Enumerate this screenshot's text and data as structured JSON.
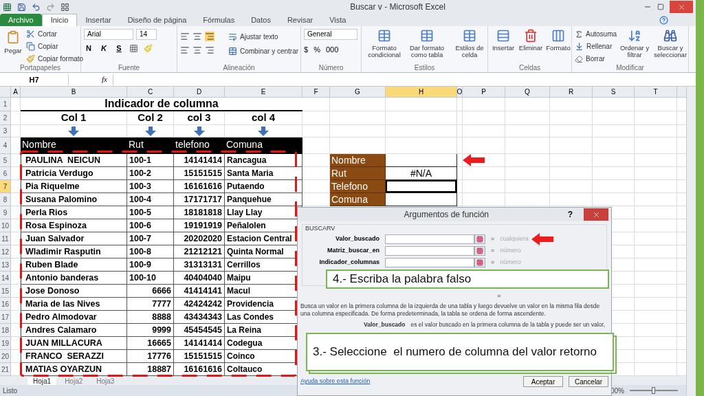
{
  "title_bar": {
    "title": "Buscar v - Microsoft Excel"
  },
  "ribbon_tabs": [
    {
      "label": "Archivo",
      "kind": "file",
      "selected": false
    },
    {
      "label": "Inicio",
      "kind": "tab",
      "selected": true
    },
    {
      "label": "Insertar",
      "kind": "tab",
      "selected": false
    },
    {
      "label": "Diseño de página",
      "kind": "tab",
      "selected": false
    },
    {
      "label": "Fórmulas",
      "kind": "tab",
      "selected": false
    },
    {
      "label": "Datos",
      "kind": "tab",
      "selected": false
    },
    {
      "label": "Revisar",
      "kind": "tab",
      "selected": false
    },
    {
      "label": "Vista",
      "kind": "tab",
      "selected": false
    }
  ],
  "ribbon": {
    "clipboard": {
      "label": "Portapapeles",
      "paste": "Pegar",
      "cut": "Cortar",
      "copy": "Copiar",
      "format_painter": "Copiar formato"
    },
    "font": {
      "label": "Fuente",
      "family": "Arial",
      "size": "14",
      "bold": "N",
      "italic": "K",
      "underline": "S"
    },
    "alignment": {
      "label": "Alineación",
      "wrap": "Ajustar texto",
      "merge": "Combinar y centrar"
    },
    "number": {
      "label": "Número",
      "format": "General",
      "currency": "$",
      "percent": "%",
      "thousands": "000"
    },
    "styles": {
      "label": "Estilos",
      "items": [
        "Formato condicional",
        "Dar formato como tabla",
        "Estilos de celda"
      ]
    },
    "cells": {
      "label": "Celdas",
      "items": [
        "Insertar",
        "Eliminar",
        "Formato"
      ]
    },
    "editing": {
      "label": "Modificar",
      "autosum": "Autosuma",
      "fill": "Rellenar",
      "clear": "Borrar",
      "sort": "Ordenar y filtrar",
      "find": "Buscar y seleccionar"
    }
  },
  "formula_bar": {
    "name_box": "H7",
    "fx": "fx"
  },
  "columns": [
    {
      "label": "A",
      "selected": false
    },
    {
      "label": "B",
      "selected": false
    },
    {
      "label": "C",
      "selected": false
    },
    {
      "label": "D",
      "selected": false
    },
    {
      "label": "E",
      "selected": false
    },
    {
      "label": "F",
      "selected": false
    },
    {
      "label": "G",
      "selected": false
    },
    {
      "label": "H",
      "selected": true
    },
    {
      "label": "O",
      "selected": false
    },
    {
      "label": "P",
      "selected": false
    },
    {
      "label": "Q",
      "selected": false
    },
    {
      "label": "R",
      "selected": false
    },
    {
      "label": "S",
      "selected": false
    },
    {
      "label": "T",
      "selected": false
    }
  ],
  "rows": [
    {
      "label": "1",
      "selected": false
    },
    {
      "label": "2",
      "selected": false
    },
    {
      "label": "3",
      "selected": false
    },
    {
      "label": "4",
      "selected": false
    },
    {
      "label": "5",
      "selected": false
    },
    {
      "label": "6",
      "selected": false
    },
    {
      "label": "7",
      "selected": true
    },
    {
      "label": "8",
      "selected": false
    },
    {
      "label": "9",
      "selected": false
    },
    {
      "label": "10",
      "selected": false
    },
    {
      "label": "11",
      "selected": false
    },
    {
      "label": "12",
      "selected": false
    },
    {
      "label": "13",
      "selected": false
    },
    {
      "label": "14",
      "selected": false
    },
    {
      "label": "15",
      "selected": false
    },
    {
      "label": "16",
      "selected": false
    },
    {
      "label": "17",
      "selected": false
    },
    {
      "label": "18",
      "selected": false
    },
    {
      "label": "19",
      "selected": false
    },
    {
      "label": "20",
      "selected": false
    },
    {
      "label": "21",
      "selected": false
    }
  ],
  "sheet": {
    "title": "Indicador de columna",
    "column_labels": [
      "Col 1",
      "Col 2",
      "col 3",
      "col 4"
    ],
    "header": [
      "Nombre",
      "Rut",
      "telefono",
      "Comuna"
    ],
    "records": [
      {
        "nombre": "PAULINA  NEICUN",
        "rut": "100-1",
        "rut_numeric": false,
        "telefono": "14141414",
        "comuna": "Rancagua"
      },
      {
        "nombre": "Patricia Verdugo",
        "rut": "100-2",
        "rut_numeric": false,
        "telefono": "15151515",
        "comuna": "Santa Maria"
      },
      {
        "nombre": "Pia Riquelme",
        "rut": "100-3",
        "rut_numeric": false,
        "telefono": "16161616",
        "comuna": "Putaendo"
      },
      {
        "nombre": "Susana Palomino",
        "rut": "100-4",
        "rut_numeric": false,
        "telefono": "17171717",
        "comuna": "Panquehue"
      },
      {
        "nombre": "Perla Rios",
        "rut": "100-5",
        "rut_numeric": false,
        "telefono": "18181818",
        "comuna": "Llay Llay"
      },
      {
        "nombre": "Rosa Espinoza",
        "rut": "100-6",
        "rut_numeric": false,
        "telefono": "19191919",
        "comuna": "Peñalolen"
      },
      {
        "nombre": "Juan Salvador",
        "rut": "100-7",
        "rut_numeric": false,
        "telefono": "20202020",
        "comuna": "Estacion Central"
      },
      {
        "nombre": "Wladimir Rasputin",
        "rut": "100-8",
        "rut_numeric": false,
        "telefono": "21212121",
        "comuna": "Quinta Normal"
      },
      {
        "nombre": "Ruben Blade",
        "rut": "100-9",
        "rut_numeric": false,
        "telefono": "31313131",
        "comuna": "Cerrillos"
      },
      {
        "nombre": "Antonio banderas",
        "rut": "100-10",
        "rut_numeric": false,
        "telefono": "40404040",
        "comuna": "Maipu"
      },
      {
        "nombre": "Jose Donoso",
        "rut": "6666",
        "rut_numeric": true,
        "telefono": "41414141",
        "comuna": "Macul"
      },
      {
        "nombre": "Maria de las Nives",
        "rut": "7777",
        "rut_numeric": true,
        "telefono": "42424242",
        "comuna": "Providencia"
      },
      {
        "nombre": "Pedro Almodovar",
        "rut": "8888",
        "rut_numeric": true,
        "telefono": "43434343",
        "comuna": "Las Condes"
      },
      {
        "nombre": "Andres Calamaro",
        "rut": "9999",
        "rut_numeric": true,
        "telefono": "45454545",
        "comuna": "La Reina"
      },
      {
        "nombre": "JUAN MILLACURA",
        "rut": "16665",
        "rut_numeric": true,
        "telefono": "14141414",
        "comuna": "Codegua"
      },
      {
        "nombre": "FRANCO  SERAZZI",
        "rut": "17776",
        "rut_numeric": true,
        "telefono": "15151515",
        "comuna": "Coinco"
      },
      {
        "nombre": "MATIAS OYARZUN",
        "rut": "18887",
        "rut_numeric": true,
        "telefono": "16161616",
        "comuna": "Coltauco"
      }
    ]
  },
  "lookup": [
    {
      "label": "Nombre",
      "selected": false
    },
    {
      "label": "Rut",
      "value": "#N/A",
      "selected": false
    },
    {
      "label": "Telefono",
      "selected": true
    },
    {
      "label": "Comuna",
      "selected": false
    }
  ],
  "dialog": {
    "title": "Argumentos de función",
    "help": "?",
    "function": "BUSCARV",
    "arguments": [
      {
        "label": "Valor_buscado",
        "equals": "=",
        "result": "cualquiera"
      },
      {
        "label": "Matriz_buscar_en",
        "equals": "=",
        "result": "número"
      },
      {
        "label": "Indicador_columnas",
        "equals": "=",
        "result": "número"
      }
    ],
    "equals": "=",
    "description": "Busca un valor en la primera columna de la izquierda de una tabla y luego devuelve un valor en la misma fila desde una columna especificada. De forma predeterminada, la tabla se ordena de forma ascendente.",
    "argument_help_label": "Valor_buscado",
    "argument_help": "es el valor buscado en la primera columna de la tabla y puede ser un valor,",
    "help_link": "Ayuda sobre esta función",
    "buttons": [
      "Aceptar",
      "Cancelar"
    ]
  },
  "callouts": [
    "4.- Escriba la palabra falso",
    "3.- Seleccione  el numero de columna del valor retorno"
  ],
  "sheet_tabs": [
    {
      "label": "Hoja1",
      "selected": true
    },
    {
      "label": "Hoja2",
      "selected": false
    },
    {
      "label": "Hoja3",
      "selected": false
    }
  ],
  "status_bar": {
    "status": "Listo",
    "zoom": "00%",
    "zoom_slider": {
      "level": 0.5
    }
  }
}
